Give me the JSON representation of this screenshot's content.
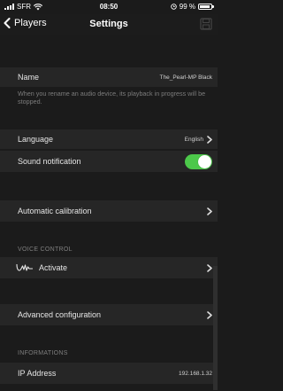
{
  "status_bar": {
    "carrier": "SFR",
    "time": "08:50",
    "battery": "99 %"
  },
  "nav": {
    "back_label": "Players",
    "title": "Settings"
  },
  "name_row": {
    "label": "Name",
    "value": "The_Pearl-MP Black"
  },
  "name_helper": "When you rename an audio device, its playback in progress will be stopped.",
  "language_row": {
    "label": "Language",
    "value": "English"
  },
  "sound_row": {
    "label": "Sound notification",
    "enabled": true
  },
  "calibration_row": {
    "label": "Automatic calibration"
  },
  "voice_control": {
    "section_title": "VOICE CONTROL",
    "activate_label": "Activate"
  },
  "advanced_row": {
    "label": "Advanced configuration"
  },
  "informations": {
    "section_title": "INFORMATIONS",
    "ip_label": "IP Address",
    "ip_value": "192.168.1.32"
  },
  "colors": {
    "accent_toggle": "#4cc84a",
    "row_bg": "#262626",
    "page_bg": "#1b1b1b"
  }
}
